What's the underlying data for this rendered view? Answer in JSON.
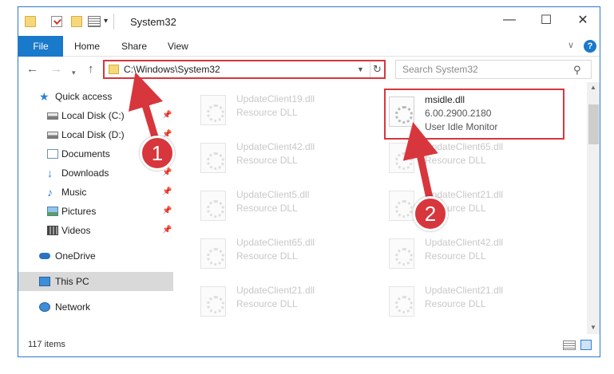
{
  "window": {
    "title": "System32",
    "minimize": "—",
    "maximize": "☐",
    "close": "✕"
  },
  "ribbon": {
    "tabs": [
      "File",
      "Home",
      "Share",
      "View"
    ],
    "help": "?"
  },
  "navbar": {
    "address": "C:\\Windows\\System32",
    "search_placeholder": "Search System32"
  },
  "sidebar": {
    "items": [
      {
        "label": "Quick access",
        "icon": "star-icon",
        "pinned": false
      },
      {
        "label": "Local Disk (C:)",
        "icon": "disk-icon",
        "pinned": true
      },
      {
        "label": "Local Disk (D:)",
        "icon": "disk-icon",
        "pinned": true
      },
      {
        "label": "Documents",
        "icon": "documents-icon",
        "pinned": true
      },
      {
        "label": "Downloads",
        "icon": "download-icon",
        "pinned": true
      },
      {
        "label": "Music",
        "icon": "music-icon",
        "pinned": true
      },
      {
        "label": "Pictures",
        "icon": "pictures-icon",
        "pinned": true
      },
      {
        "label": "Videos",
        "icon": "videos-icon",
        "pinned": true
      },
      {
        "label": "OneDrive",
        "icon": "onedrive-icon",
        "pinned": false
      },
      {
        "label": "This PC",
        "icon": "pc-icon",
        "pinned": false,
        "selected": true
      },
      {
        "label": "Network",
        "icon": "network-icon",
        "pinned": false
      }
    ]
  },
  "files": {
    "left_column": [
      {
        "name": "UpdateClient19.dll",
        "type": "Resource DLL"
      },
      {
        "name": "UpdateClient42.dll",
        "type": "Resource DLL"
      },
      {
        "name": "UpdateClient5.dll",
        "type": "Resource DLL"
      },
      {
        "name": "UpdateClient65.dll",
        "type": "Resource DLL"
      },
      {
        "name": "UpdateClient21.dll",
        "type": "Resource DLL"
      }
    ],
    "highlighted": {
      "name": "msidle.dll",
      "version": "6.00.2900.2180",
      "description": "User Idle Monitor"
    },
    "right_column": [
      {
        "name": "UpdateClient65.dll",
        "type": "Resource DLL"
      },
      {
        "name": "UpdateClient21.dll",
        "type": "Resource DLL"
      },
      {
        "name": "UpdateClient42.dll",
        "type": "Resource DLL"
      },
      {
        "name": "UpdateClient21.dll",
        "type": "Resource DLL"
      }
    ]
  },
  "status": {
    "item_count": "117 items"
  },
  "annotations": {
    "step1": "1",
    "step2": "2"
  },
  "colors": {
    "accent": "#1979ca",
    "highlight_red": "#d8363d",
    "faded_text": "#c8c8c8"
  }
}
